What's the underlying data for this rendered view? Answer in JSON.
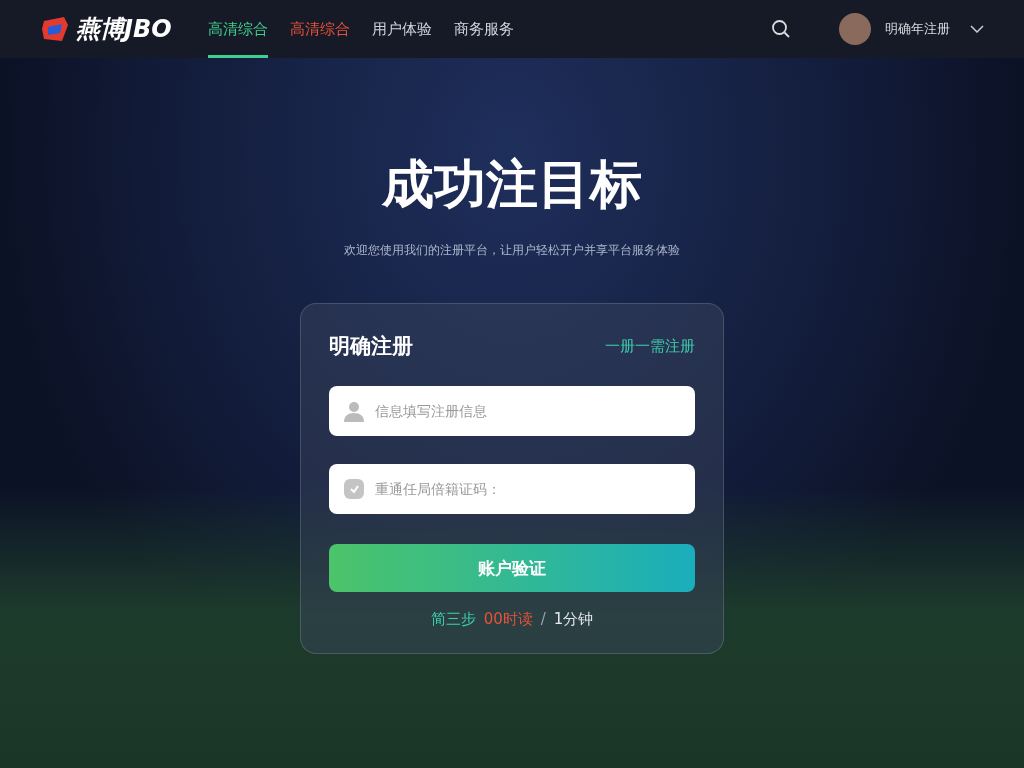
{
  "brand": {
    "name": "燕博JBO"
  },
  "nav": [
    {
      "label": "高清综合",
      "selected": true,
      "color": "#3fcf8e"
    },
    {
      "label": "高清综合",
      "selected": false,
      "color": "#e8503a"
    },
    {
      "label": "用户体验",
      "selected": false,
      "color": "#d0d4dc"
    },
    {
      "label": "商务服务",
      "selected": false,
      "color": "#d0d4dc"
    }
  ],
  "user": {
    "name": "明确年注册"
  },
  "hero": {
    "title": "成功注目标",
    "subtitle": "欢迎您使用我们的注册平台，让用户轻松开户并享平台服务体验"
  },
  "form": {
    "title": "明确注册",
    "link": "一册一需注册",
    "fields": [
      {
        "kind": "user",
        "placeholder": "信息填写注册信息"
      },
      {
        "kind": "code",
        "placeholder": "重通任局倍籍证码："
      }
    ],
    "submit": "账户验证",
    "footer": [
      {
        "text": "简三步",
        "color": "#3fcfae"
      },
      {
        "text": "00时读",
        "color": "#e8503a"
      },
      {
        "text": "/",
        "color": "#9aa0aa"
      },
      {
        "text": "1分钟",
        "color": "#e6e8ee"
      }
    ]
  }
}
